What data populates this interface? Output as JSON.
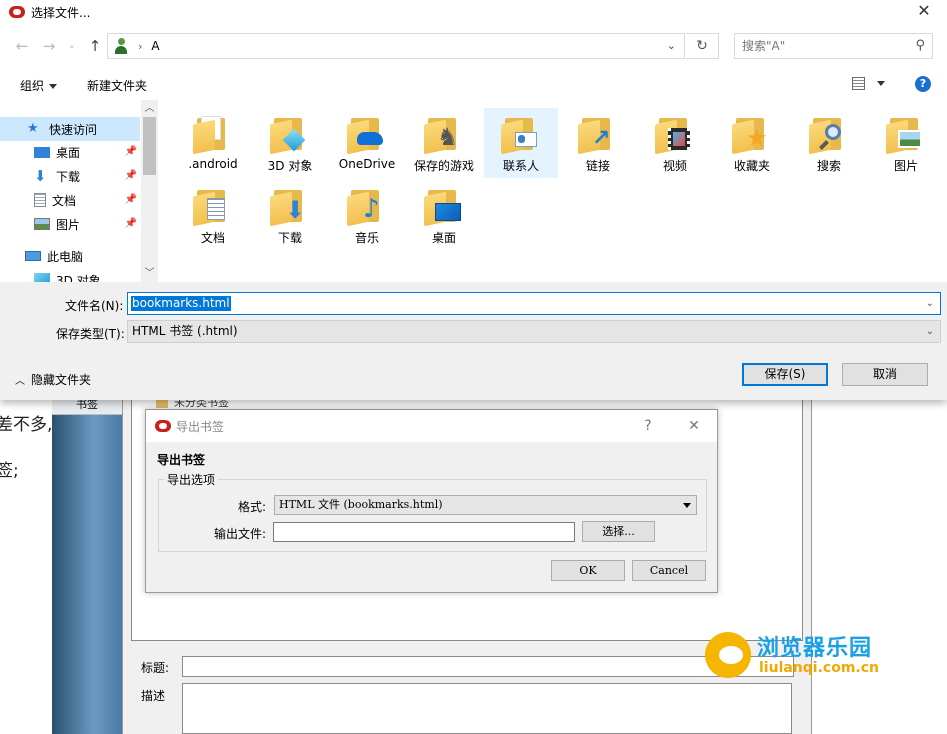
{
  "file_dialog": {
    "title": "选择文件...",
    "close_glyph": "✕",
    "address": {
      "crumb": "A"
    },
    "search": {
      "placeholder": "搜索\"A\""
    },
    "toolbar": {
      "organize": "组织",
      "new_folder": "新建文件夹",
      "help": "?"
    },
    "nav_pane": [
      {
        "label": "快速访问",
        "icon": "star-icon",
        "selected": true,
        "pinned": false
      },
      {
        "label": "桌面",
        "icon": "desktop-icon",
        "selected": false,
        "pinned": true
      },
      {
        "label": "下载",
        "icon": "download-icon",
        "selected": false,
        "pinned": true
      },
      {
        "label": "文档",
        "icon": "document-icon",
        "selected": false,
        "pinned": true
      },
      {
        "label": "图片",
        "icon": "picture-icon",
        "selected": false,
        "pinned": true
      },
      {
        "label": "此电脑",
        "icon": "computer-icon",
        "selected": false,
        "pinned": false
      },
      {
        "label": "3D 对象",
        "icon": "3d-objects-icon",
        "selected": false,
        "pinned": false
      }
    ],
    "folders": [
      {
        "label": ".android",
        "icon": "folder-icon"
      },
      {
        "label": "3D 对象",
        "icon": "3d-objects-folder-icon"
      },
      {
        "label": "OneDrive",
        "icon": "onedrive-folder-icon"
      },
      {
        "label": "保存的游戏",
        "icon": "saved-games-folder-icon"
      },
      {
        "label": "联系人",
        "icon": "contacts-folder-icon"
      },
      {
        "label": "链接",
        "icon": "links-folder-icon"
      },
      {
        "label": "视频",
        "icon": "videos-folder-icon"
      },
      {
        "label": "收藏夹",
        "icon": "favorites-folder-icon"
      },
      {
        "label": "搜索",
        "icon": "searches-folder-icon"
      },
      {
        "label": "图片",
        "icon": "pictures-folder-icon"
      },
      {
        "label": "文档",
        "icon": "documents-folder-icon"
      },
      {
        "label": "下载",
        "icon": "downloads-folder-icon"
      },
      {
        "label": "音乐",
        "icon": "music-folder-icon"
      },
      {
        "label": "桌面",
        "icon": "desktop-folder-icon"
      }
    ],
    "filename_label": "文件名(N):",
    "filename_value": "bookmarks.html",
    "filetype_label": "保存类型(T):",
    "filetype_value": "HTML 书签  (.html)",
    "hide_folders": "隐藏文件夹",
    "save_button": "保存(S)",
    "cancel_button": "取消"
  },
  "export_dialog": {
    "title": "导出书签",
    "help_glyph": "?",
    "close_glyph": "✕",
    "heading": "导出书签",
    "group_label": "导出选项",
    "format_label": "格式:",
    "format_value": "HTML 文件 (bookmarks.html)",
    "output_label": "输出文件:",
    "output_value": "",
    "choose_button": "选择...",
    "ok_button": "OK",
    "cancel_button": "Cancel"
  },
  "background_app": {
    "text_line_1": "差不多,",
    "text_line_2": "签;",
    "sidebar_tab": "书签",
    "tree_item": "未分类书签",
    "title_label": "标题:",
    "desc_label": "描述"
  },
  "watermark": {
    "name": "浏览器乐园",
    "url": "liulanqi.com.cn"
  },
  "colors": {
    "accent": "#0078d7",
    "selection": "#cce8ff",
    "watermark_blue": "#1aa0e6",
    "watermark_orange": "#f2a800"
  }
}
